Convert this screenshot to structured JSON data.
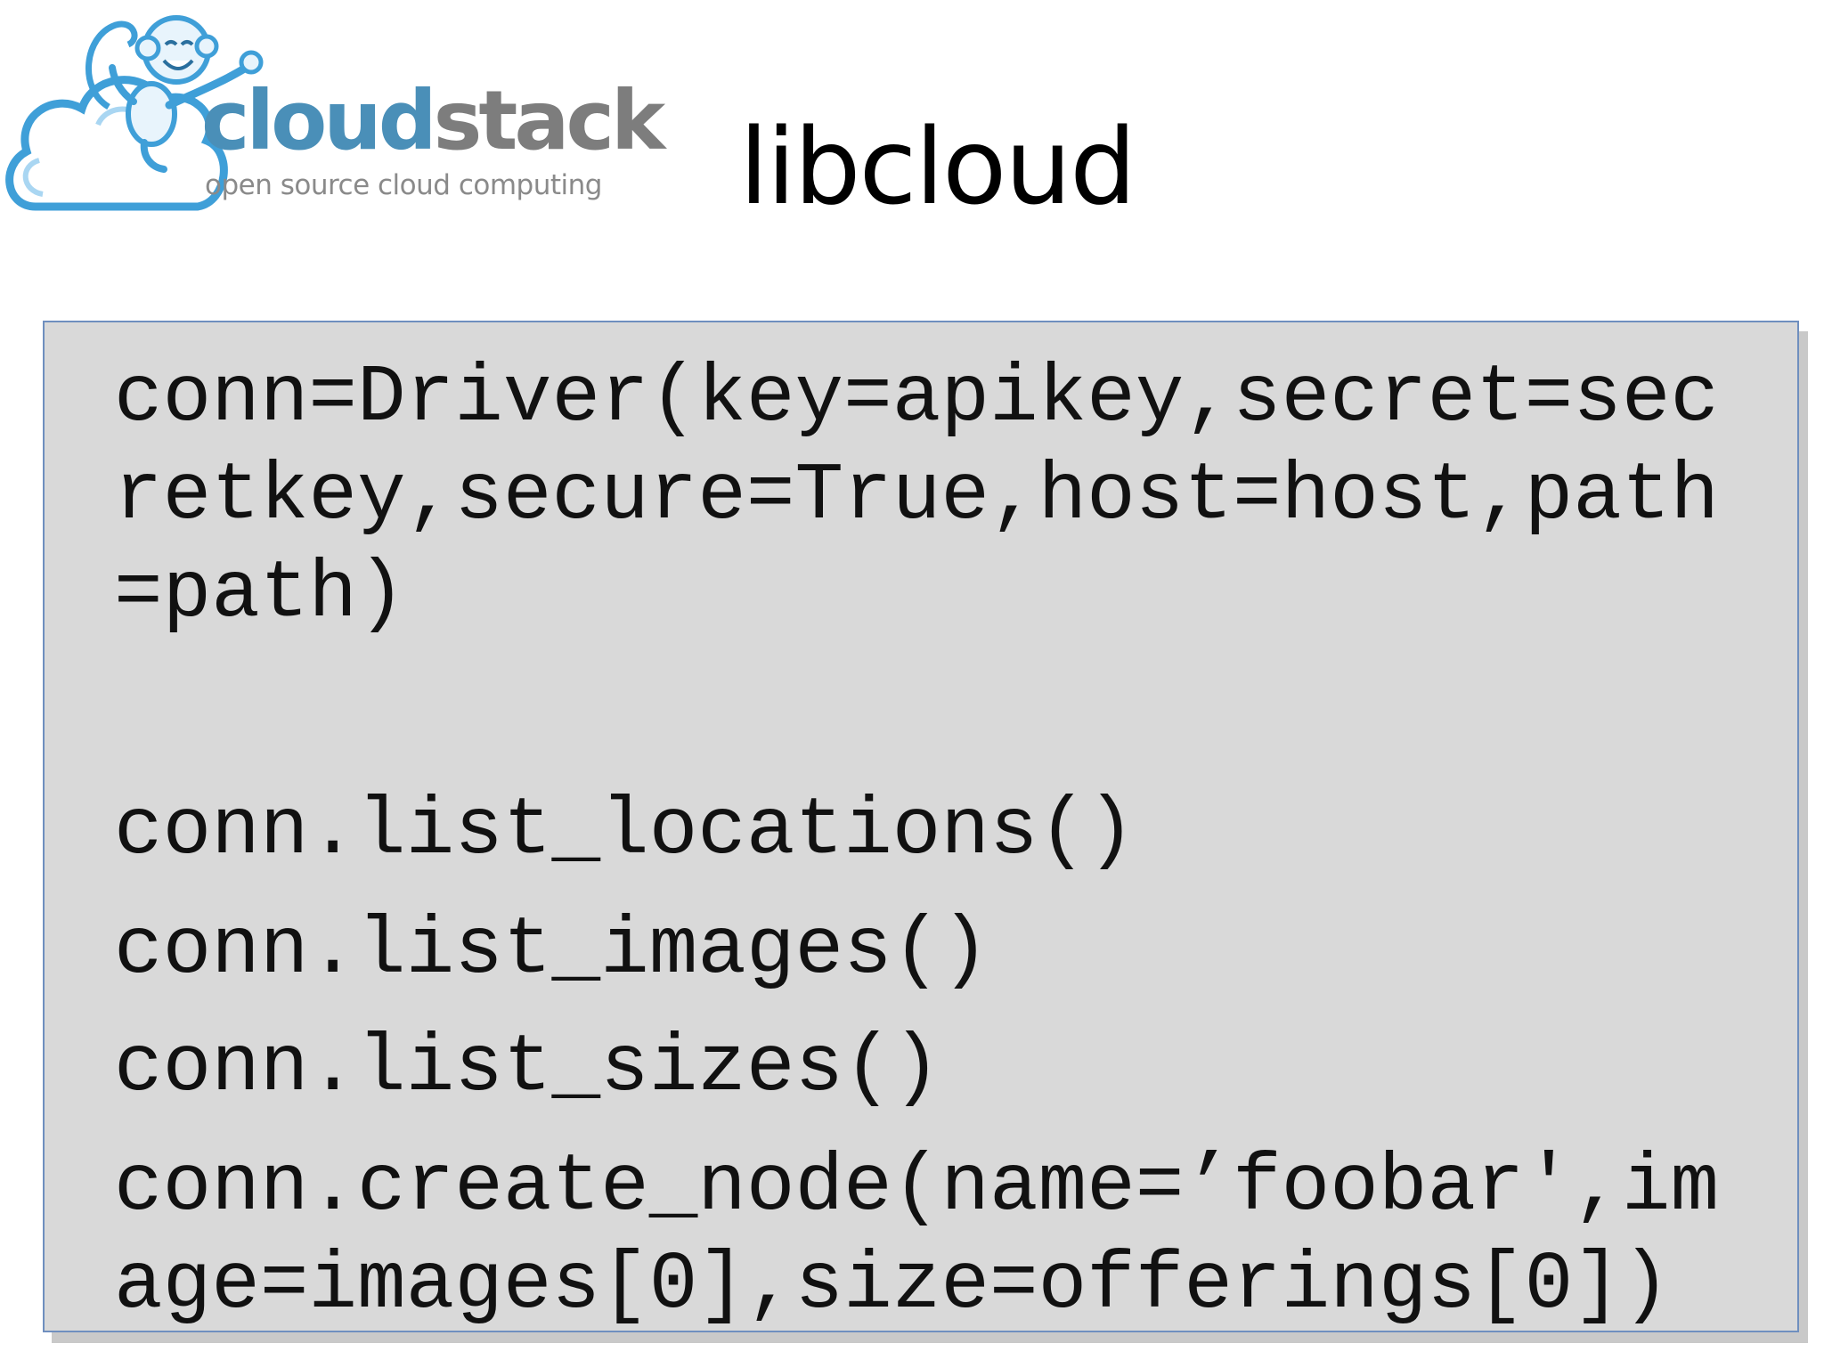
{
  "logo": {
    "word_part1": "cloud",
    "word_part2": "stack",
    "tagline": "open source cloud computing",
    "icon": "cloud-monkey-logo"
  },
  "slide": {
    "title": "libcloud"
  },
  "code": {
    "lines": [
      "conn=Driver(key=apikey,secret=sec",
      "retkey,secure=True,host=host,path",
      "=path)",
      "conn.list_locations()",
      "conn.list_images()",
      "conn.list_sizes()",
      "conn.create_node(name=’foobar',im",
      "age=images[0],size=offerings[0])"
    ]
  },
  "colors": {
    "code_background": "#d9d9d9",
    "code_border": "#6f8fbf",
    "logo_blue": "#4a8fb8",
    "logo_gray": "#7d7d7d"
  }
}
